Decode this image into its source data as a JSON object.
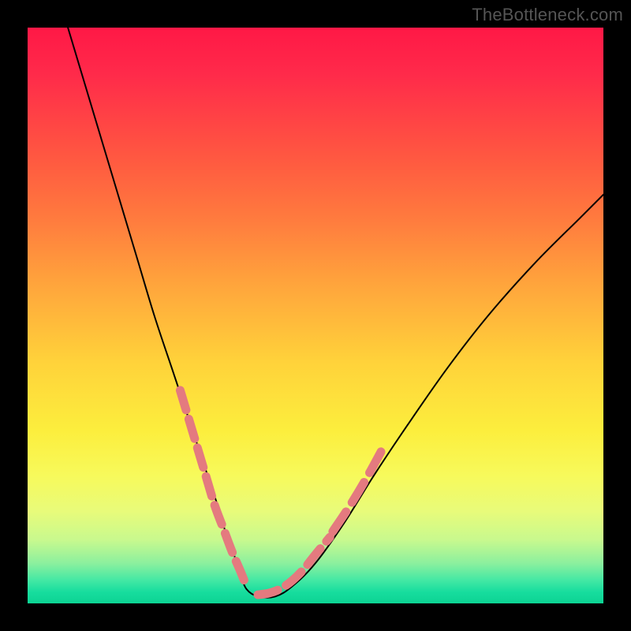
{
  "watermark": "TheBottleneck.com",
  "chart_data": {
    "type": "line",
    "title": "",
    "xlabel": "",
    "ylabel": "",
    "xlim": [
      0,
      100
    ],
    "ylim": [
      0,
      100
    ],
    "grid": false,
    "legend": false,
    "series": [
      {
        "name": "v-curve",
        "stroke": "#000000",
        "stroke_width": 2,
        "x": [
          7,
          10,
          13,
          16,
          19,
          22,
          25,
          27,
          29,
          31,
          33,
          34.5,
          36,
          37,
          38,
          40,
          43,
          46,
          50,
          55,
          60,
          66,
          73,
          80,
          88,
          96,
          100
        ],
        "y": [
          100,
          90,
          80,
          70,
          60,
          50,
          41,
          35,
          29,
          23,
          17,
          12,
          8,
          5,
          2.5,
          1.2,
          1.2,
          3,
          7,
          14,
          22,
          31,
          41,
          50,
          59,
          67,
          71
        ]
      },
      {
        "name": "pink-dashes-left",
        "stroke": "#e47a7f",
        "stroke_width": 11,
        "dash": [
          26,
          12
        ],
        "x": [
          26.5,
          28,
          29.5,
          31,
          32.5,
          34,
          35.5,
          37,
          38
        ],
        "y": [
          37,
          32,
          27,
          22,
          17,
          13,
          9,
          5.5,
          3
        ]
      },
      {
        "name": "pink-dashes-right",
        "stroke": "#e47a7f",
        "stroke_width": 11,
        "dash": [
          26,
          12
        ],
        "x": [
          40,
          42,
          44,
          46,
          48,
          50,
          52.5
        ],
        "y": [
          1.5,
          1.8,
          2.6,
          4,
          6,
          8.5,
          11.5
        ]
      },
      {
        "name": "pink-dashes-right-upper",
        "stroke": "#e47a7f",
        "stroke_width": 11,
        "dash": [
          30,
          14
        ],
        "x": [
          53,
          56,
          59,
          62
        ],
        "y": [
          12.5,
          17,
          22,
          27.5
        ]
      }
    ],
    "colors": {
      "gradient_top": "#ff1846",
      "gradient_mid": "#ffd23a",
      "gradient_bottom": "#0cd393",
      "curve": "#000000",
      "marker": "#e47a7f",
      "frame": "#000000"
    }
  }
}
